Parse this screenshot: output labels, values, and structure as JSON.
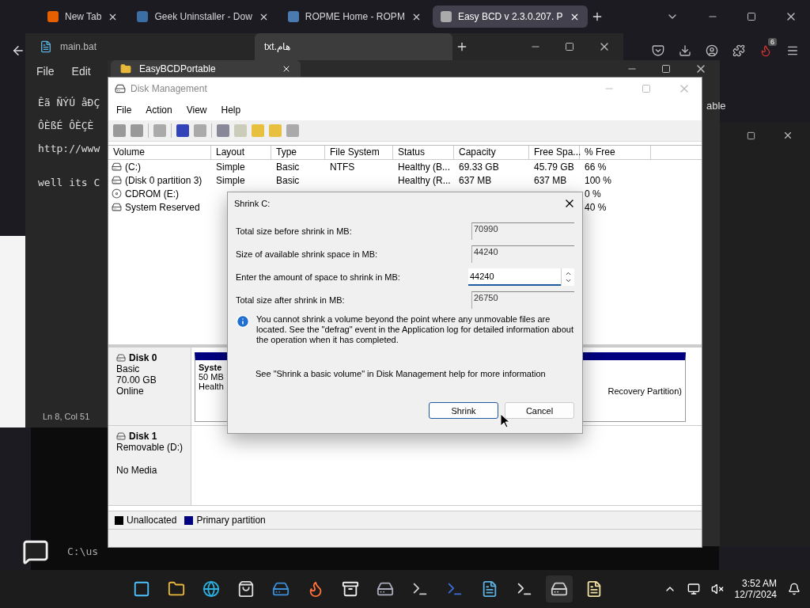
{
  "browser": {
    "tabs": [
      {
        "label": "New Tab",
        "selected": false
      },
      {
        "label": "Geek Uninstaller - Dow",
        "selected": false
      },
      {
        "label": "ROPME Home - ROPM",
        "selected": false
      },
      {
        "label": "Easy BCD v 2.3.0.207. P",
        "selected": true
      }
    ],
    "badge": "6"
  },
  "notepad": {
    "tabs": [
      {
        "label": "main.bat",
        "selected": false
      },
      {
        "label": "هام.txt",
        "selected": true
      }
    ],
    "menu": [
      "File",
      "Edit"
    ],
    "lines": [
      "Êã ÑÝÚ åÐÇ",
      "ÔÈßÉ ÔÈÇÈ",
      "http://www",
      "well its C"
    ],
    "status": "Ln 8, Col 51"
  },
  "explorer": {
    "tab": "EasyBCDPortable",
    "fragment": "able"
  },
  "terminal": {
    "fragment": "C:\\us"
  },
  "disk_management": {
    "title": "Disk Management",
    "menu": [
      "File",
      "Action",
      "View",
      "Help"
    ],
    "columns": [
      "Volume",
      "Layout",
      "Type",
      "File System",
      "Status",
      "Capacity",
      "Free Spa...",
      "% Free"
    ],
    "rows": [
      {
        "kind": "disk",
        "covered": false,
        "cells": [
          "(C:)",
          "Simple",
          "Basic",
          "NTFS",
          "Healthy (B...",
          "69.33 GB",
          "45.79 GB",
          "66 %"
        ]
      },
      {
        "kind": "disk",
        "covered": false,
        "cells": [
          "(Disk 0 partition 3)",
          "Simple",
          "Basic",
          "",
          "Healthy (R...",
          "637 MB",
          "637 MB",
          "100 %"
        ]
      },
      {
        "kind": "cdrom",
        "covered": true,
        "cells": [
          "CDROM (E:)",
          "0 %"
        ]
      },
      {
        "kind": "disk",
        "covered": true,
        "cells": [
          "System Reserved",
          "40 %"
        ]
      }
    ],
    "disks": [
      {
        "name": "Disk 0",
        "info": [
          "Basic",
          "70.00 GB",
          "Online"
        ],
        "partitions": [
          {
            "lines": [
              "Syste",
              "50 MB",
              "Health"
            ]
          },
          {
            "lines": [
              "Recovery Partition)"
            ]
          }
        ]
      },
      {
        "name": "Disk 1",
        "info": [
          "Removable (D:)",
          "No Media"
        ]
      }
    ],
    "legend": [
      {
        "label": "Unallocated",
        "color": "#000000"
      },
      {
        "label": "Primary partition",
        "color": "#000080"
      }
    ]
  },
  "dialog": {
    "title": "Shrink C:",
    "fields": [
      {
        "label": "Total size before shrink in MB:",
        "value": "70990",
        "editable": false
      },
      {
        "label": "Size of available shrink space in MB:",
        "value": "44240",
        "editable": false
      },
      {
        "label": "Enter the amount of space to shrink in MB:",
        "value": "44240",
        "editable": true
      },
      {
        "label": "Total size after shrink in MB:",
        "value": "26750",
        "editable": false
      }
    ],
    "info": "You cannot shrink a volume beyond the point where any unmovable files are located. See the \"defrag\" event in the Application log for detailed information about the operation when it has completed.",
    "help": "See \"Shrink a basic volume\" in Disk Management help for more information",
    "buttons": [
      {
        "label": "Shrink",
        "selected": true
      },
      {
        "label": "Cancel",
        "selected": false
      }
    ]
  },
  "taskbar": {
    "time": "3:52 AM",
    "date": "12/7/2024"
  }
}
